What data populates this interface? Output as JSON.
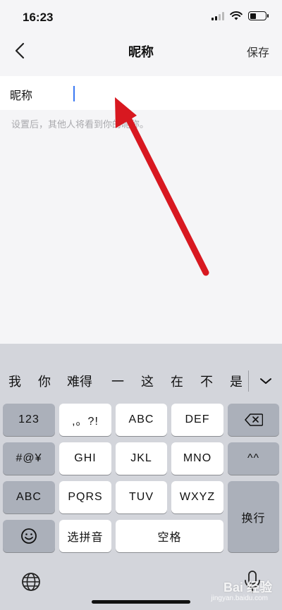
{
  "status_bar": {
    "time": "16:23"
  },
  "nav": {
    "title": "昵称",
    "save_label": "保存"
  },
  "form": {
    "field_label": "昵称",
    "field_value": "",
    "hint": "设置后，其他人将看到你的昵称。"
  },
  "annotation": {
    "arrow_color": "#e8141b"
  },
  "keyboard": {
    "candidates": [
      "我",
      "你",
      "难得",
      "一",
      "这",
      "在",
      "不",
      "是"
    ],
    "keys": {
      "num": "123",
      "punct": ",。?!",
      "abc_top": "ABC",
      "def": "DEF",
      "symbols": "#@¥",
      "ghi": "GHI",
      "jkl": "JKL",
      "mno": "MNO",
      "emoticon": "^^",
      "abc_switch": "ABC",
      "pqrs": "PQRS",
      "tuv": "TUV",
      "wxyz": "WXYZ",
      "return": "换行",
      "pinyin": "选拼音",
      "space": "空格"
    }
  },
  "watermark": {
    "brand": "Bai 经验",
    "url": "jingyan.baidu.com"
  }
}
